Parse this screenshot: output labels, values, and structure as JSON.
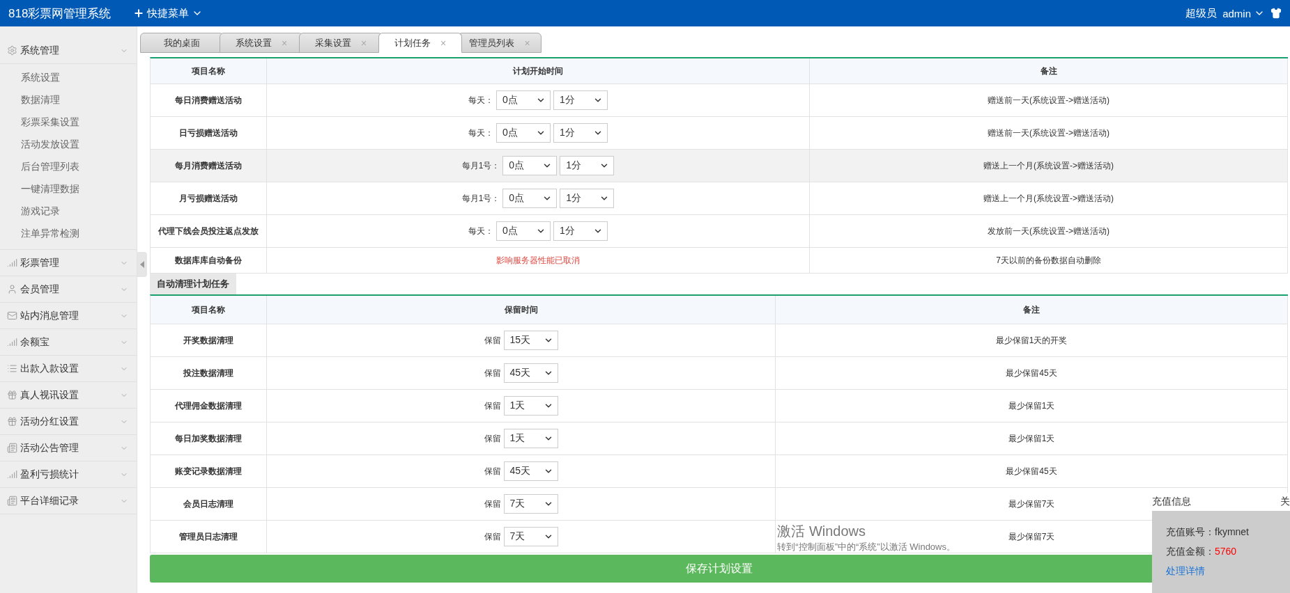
{
  "header": {
    "title": "818彩票网管理系统",
    "quick_menu": "快捷菜单",
    "role": "超级员",
    "user": "admin"
  },
  "sidebar": {
    "groups": [
      {
        "label": "系统管理",
        "kind": "gear",
        "children": [
          {
            "label": "系统设置"
          },
          {
            "label": "数据清理"
          },
          {
            "label": "彩票采集设置"
          },
          {
            "label": "活动发放设置"
          },
          {
            "label": "后台管理列表"
          },
          {
            "label": "一键清理数据"
          },
          {
            "label": "游戏记录"
          },
          {
            "label": "注单异常检测"
          }
        ]
      },
      {
        "label": "彩票管理",
        "kind": "chart"
      },
      {
        "label": "会员管理",
        "kind": "user"
      },
      {
        "label": "站内消息管理",
        "kind": "mail"
      },
      {
        "label": "余额宝",
        "kind": "chart"
      },
      {
        "label": "出款入款设置",
        "kind": "list"
      },
      {
        "label": "真人视讯设置",
        "kind": "gift"
      },
      {
        "label": "活动分红设置",
        "kind": "gift"
      },
      {
        "label": "活动公告管理",
        "kind": "news"
      },
      {
        "label": "盈利亏损统计",
        "kind": "chart"
      },
      {
        "label": "平台详细记录",
        "kind": "news"
      }
    ]
  },
  "tabs": [
    {
      "label": "我的桌面",
      "selected": false
    },
    {
      "label": "系统设置",
      "close": "×",
      "selected": false
    },
    {
      "label": "采集设置",
      "close": "×",
      "selected": false
    },
    {
      "label": "计划任务",
      "close": "×",
      "selected": true
    },
    {
      "label": "管理员列表",
      "close": "×",
      "selected": false
    }
  ],
  "schedule": {
    "columns": [
      "项目名称",
      "计划开始时间",
      "备注"
    ],
    "rows": [
      {
        "kind": "time",
        "name": "每日消费赠送活动",
        "prefix": "每天：",
        "hour": "0点",
        "minute": "1分",
        "note": "赠送前一天(系统设置->赠送活动)",
        "highlighted": false
      },
      {
        "kind": "time",
        "name": "日亏损赠送活动",
        "prefix": "每天：",
        "hour": "0点",
        "minute": "1分",
        "note": "赠送前一天(系统设置->赠送活动)",
        "highlighted": false
      },
      {
        "kind": "time",
        "name": "每月消费赠送活动",
        "prefix": "每月1号：",
        "hour": "0点",
        "minute": "1分",
        "note": "赠送上一个月(系统设置->赠送活动)",
        "highlighted": true
      },
      {
        "kind": "time",
        "name": "月亏损赠送活动",
        "prefix": "每月1号：",
        "hour": "0点",
        "minute": "1分",
        "note": "赠送上一个月(系统设置->赠送活动)",
        "highlighted": false
      },
      {
        "kind": "time",
        "name": "代理下线会员投注返点发放",
        "prefix": "每天：",
        "hour": "0点",
        "minute": "1分",
        "note": "发放前一天(系统设置->赠送活动)",
        "highlighted": false
      },
      {
        "kind": "notice",
        "name": "数据库库自动备份",
        "notice": "影响服务器性能已取消",
        "note": "7天以前的备份数据自动删除",
        "highlighted": false
      }
    ]
  },
  "cleanup": {
    "title": "自动清理计划任务",
    "columns": [
      "项目名称",
      "保留时间",
      "备注"
    ],
    "rows": [
      {
        "name": "开奖数据清理",
        "prefix": "保留",
        "days": "15天",
        "note": "最少保留1天的开奖"
      },
      {
        "name": "投注数据清理",
        "prefix": "保留",
        "days": "45天",
        "note": "最少保留45天"
      },
      {
        "name": "代理佣金数据清理",
        "prefix": "保留",
        "days": "1天",
        "note": "最少保留1天"
      },
      {
        "name": "每日加奖数据清理",
        "prefix": "保留",
        "days": "1天",
        "note": "最少保留1天"
      },
      {
        "name": "账变记录数据清理",
        "prefix": "保留",
        "days": "45天",
        "note": "最少保留45天"
      },
      {
        "name": "会员日志清理",
        "prefix": "保留",
        "days": "7天",
        "note": "最少保留7天"
      },
      {
        "name": "管理员日志清理",
        "prefix": "保留",
        "days": "7天",
        "note": "最少保留7天"
      }
    ]
  },
  "save_button": "保存计划设置",
  "popup": {
    "title": "充值信息",
    "close": "关",
    "account_label": "充值账号：",
    "account": "fkymnet",
    "amount_label": "充值金额：",
    "amount": "5760",
    "link": "处理详情"
  },
  "os_overlay": {
    "title": "激活 Windows",
    "hint": "转到“控制面板”中的“系统”以激活 Windows。"
  }
}
